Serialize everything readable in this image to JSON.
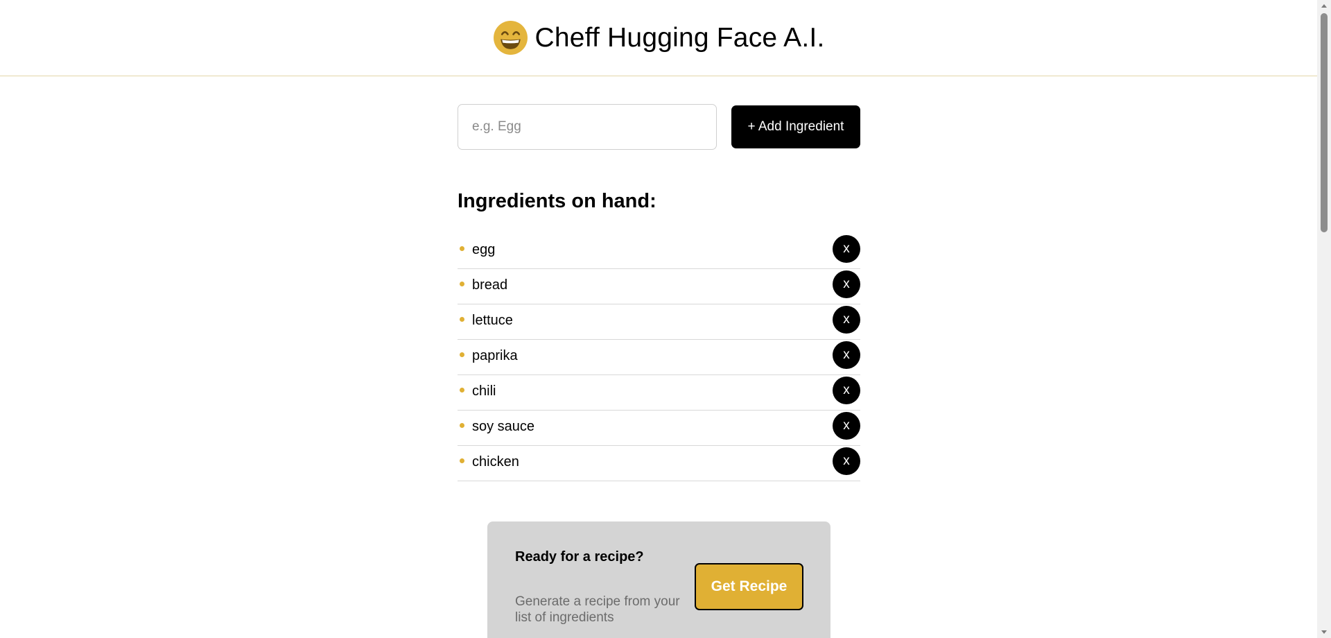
{
  "header": {
    "logo_icon": "grinning-face-icon",
    "title": "Cheff Hugging Face A.I.",
    "accent_color": "#e0b034"
  },
  "form": {
    "input_placeholder": "e.g. Egg",
    "input_value": "",
    "add_button_label": "+ Add Ingredient"
  },
  "ingredients": {
    "heading": "Ingredients on hand:",
    "remove_label": "x",
    "items": [
      {
        "name": "egg"
      },
      {
        "name": "bread"
      },
      {
        "name": "lettuce"
      },
      {
        "name": "paprika"
      },
      {
        "name": "chili"
      },
      {
        "name": "soy sauce"
      },
      {
        "name": "chicken"
      }
    ]
  },
  "cta": {
    "title": "Ready for a recipe?",
    "subtitle": "Generate a recipe from your list of ingredients",
    "button_label": "Get Recipe",
    "button_color": "#e0b034"
  }
}
